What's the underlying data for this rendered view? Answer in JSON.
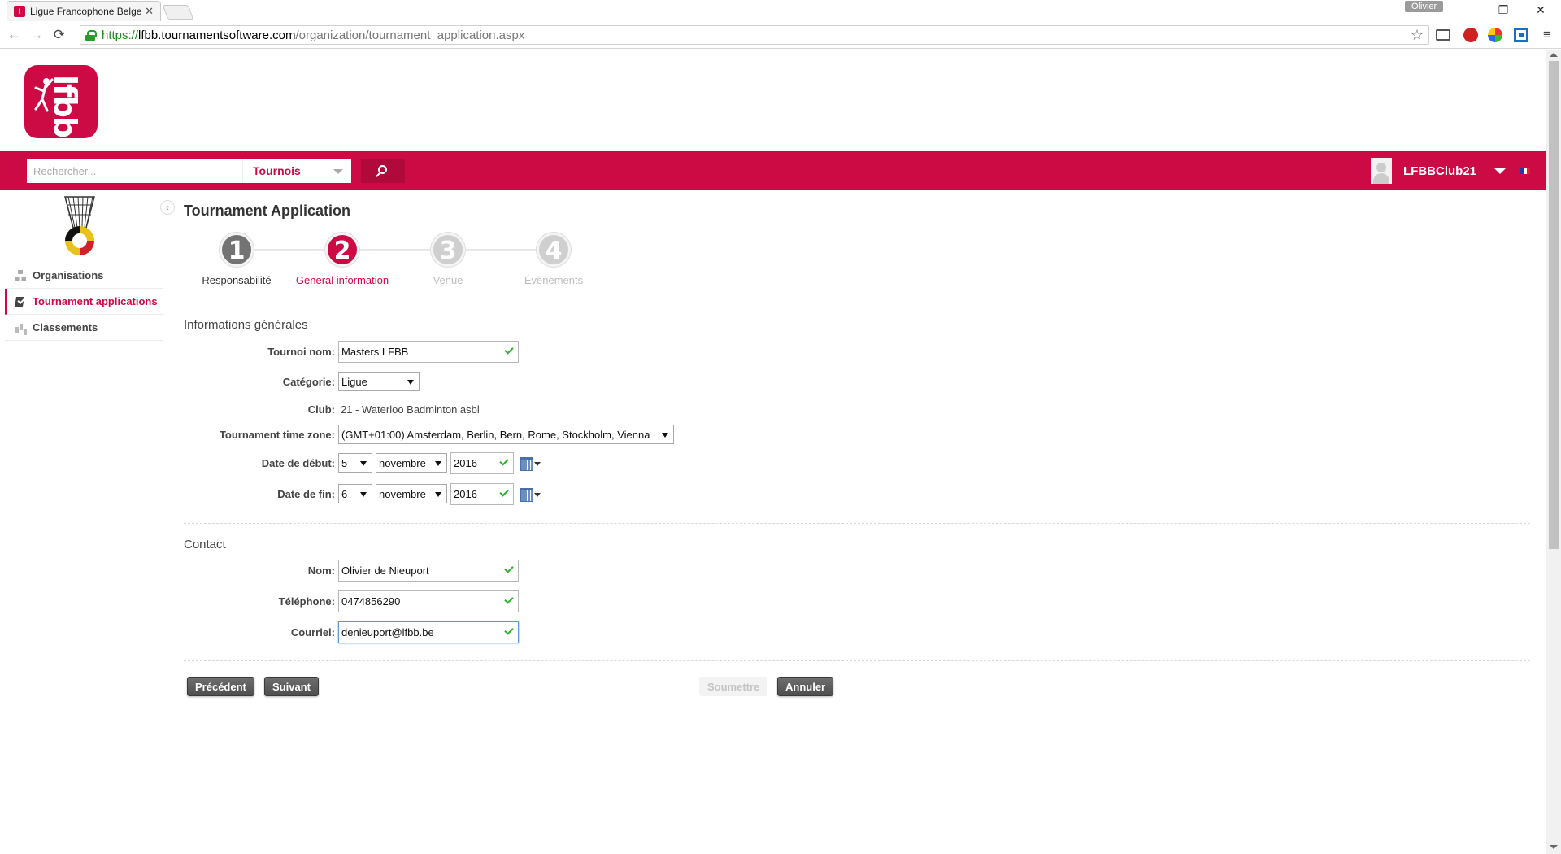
{
  "browser": {
    "tab_title": "Ligue Francophone Belge",
    "tab_close": "✕",
    "profile_name": "Olivier",
    "url_scheme": "https://",
    "url_host": "lfbb.tournamentsoftware.com",
    "url_path": "/organization/tournament_application.aspx",
    "back": "←",
    "forward": "→",
    "reload": "⟳",
    "minimize": "–",
    "restore": "❐",
    "close": "✕",
    "star": "☆",
    "menu": "≡"
  },
  "header": {
    "logo_text": "lfbb",
    "search_placeholder": "Rechercher...",
    "search_scope": "Tournois",
    "username": "LFBBClub21",
    "brand_color": "#cc0b45"
  },
  "sidebar": {
    "collapse": "‹",
    "items": [
      {
        "label": "Organisations",
        "icon": "organisations-icon"
      },
      {
        "label": "Tournament applications",
        "icon": "application-icon",
        "active": true
      },
      {
        "label": "Classements",
        "icon": "rankings-icon"
      }
    ]
  },
  "main": {
    "title": "Tournament Application",
    "steps": [
      {
        "number": "1",
        "label": "Responsabilité",
        "state": "done"
      },
      {
        "number": "2",
        "label": "General information",
        "state": "current"
      },
      {
        "number": "3",
        "label": "Venue",
        "state": "todo"
      },
      {
        "number": "4",
        "label": "Évènements",
        "state": "todo"
      }
    ],
    "general": {
      "section_title": "Informations générales",
      "tournament_name_label": "Tournoi nom:",
      "tournament_name_value": "Masters LFBB",
      "category_label": "Catégorie:",
      "category_value": "Ligue",
      "club_label": "Club:",
      "club_value": "21 - Waterloo Badminton asbl",
      "timezone_label": "Tournament time zone:",
      "timezone_value": "(GMT+01:00) Amsterdam, Berlin, Bern, Rome, Stockholm, Vienna",
      "start_label": "Date de début:",
      "start_day": "5",
      "start_month": "novembre",
      "start_year": "2016",
      "end_label": "Date de fin:",
      "end_day": "6",
      "end_month": "novembre",
      "end_year": "2016"
    },
    "contact": {
      "section_title": "Contact",
      "name_label": "Nom:",
      "name_value": "Olivier de Nieuport",
      "phone_label": "Téléphone:",
      "phone_value": "0474856290",
      "email_label": "Courriel:",
      "email_value": "denieuport@lfbb.be"
    },
    "buttons": {
      "previous": "Précédent",
      "next": "Suivant",
      "submit": "Soumettre",
      "cancel": "Annuler"
    }
  }
}
